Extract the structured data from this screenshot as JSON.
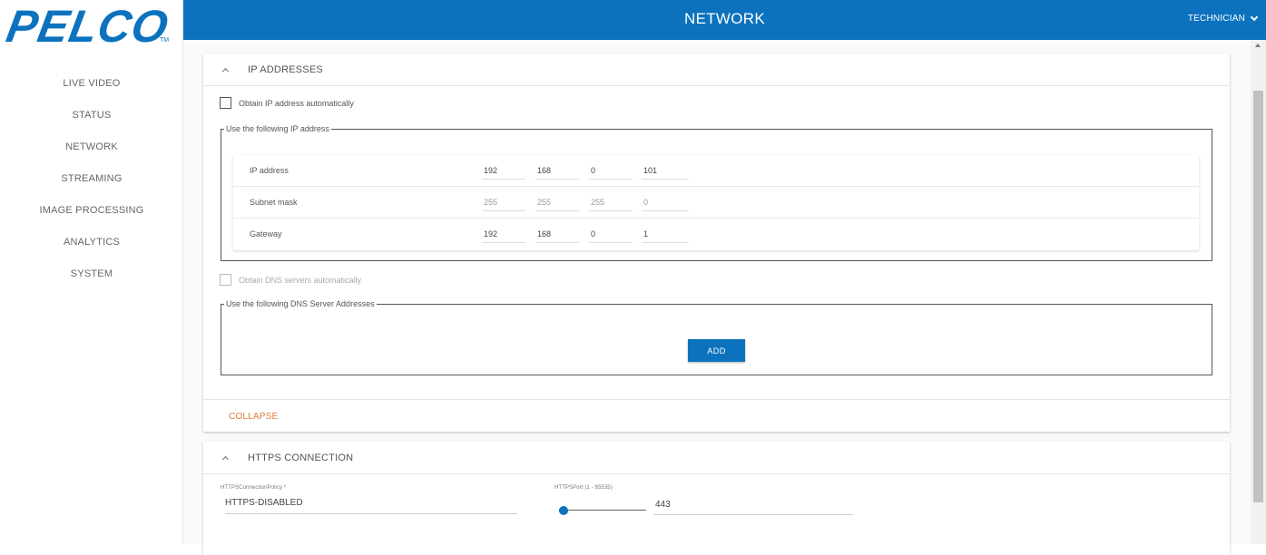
{
  "brand": {
    "logo_text": "PELCO",
    "trademark": "TM",
    "color": "#0c72bd"
  },
  "sidebar": {
    "items": [
      {
        "label": "LIVE VIDEO"
      },
      {
        "label": "STATUS"
      },
      {
        "label": "NETWORK"
      },
      {
        "label": "STREAMING"
      },
      {
        "label": "IMAGE PROCESSING"
      },
      {
        "label": "ANALYTICS"
      },
      {
        "label": "SYSTEM"
      }
    ]
  },
  "header": {
    "title": "NETWORK",
    "user": "TECHNICIAN",
    "user_icon": "chevron-down-icon"
  },
  "ip_section": {
    "title": "IP ADDRESSES",
    "toggle_icon": "chevron-up-icon",
    "obtain_ip_auto": {
      "label": "Obtain IP address automatically",
      "checked": false
    },
    "static_legend": "Use the following IP address",
    "rows": [
      {
        "label": "IP address",
        "octets": [
          "192",
          "168",
          "0",
          "101"
        ]
      },
      {
        "label": "Subnet mask",
        "octets": [
          "255",
          "255",
          "255",
          "0"
        ]
      },
      {
        "label": "Gateway",
        "octets": [
          "192",
          "168",
          "0",
          "1"
        ]
      }
    ],
    "obtain_dns_auto": {
      "label": "Obtain DNS servers automatically",
      "checked": false,
      "disabled": true
    },
    "dns_legend": "Use the following DNS Server Addresses",
    "add_label": "ADD",
    "collapse_label": "COLLAPSE"
  },
  "https_section": {
    "title": "HTTPS CONNECTION",
    "toggle_icon": "chevron-up-icon",
    "policy": {
      "label": "HTTPSConnectionPolicy *",
      "value": "HTTPS-DISABLED"
    },
    "port": {
      "label": "HTTPSPort (1 - 65535)",
      "value": "443",
      "min": 1,
      "max": 65535
    }
  },
  "colors": {
    "accent": "#0c72bd",
    "collapse": "#e07a3c"
  }
}
